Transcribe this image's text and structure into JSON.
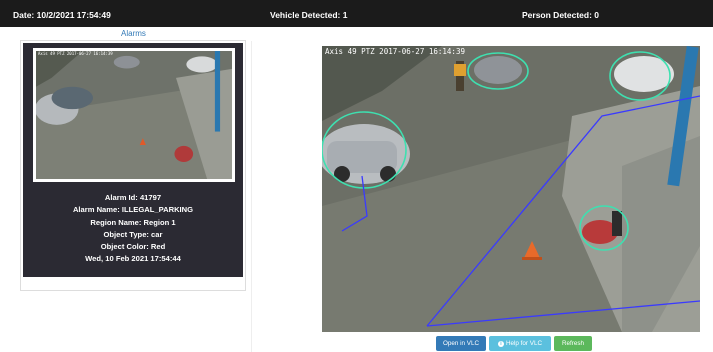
{
  "header": {
    "date": "Date: 10/2/2021 17:54:49",
    "vehicle": "Vehicle Detected: 1",
    "person": "Person Detected: 0"
  },
  "tabs": {
    "alarms_label": "Alarms"
  },
  "alarm": {
    "thumb_overlay": "Axis 49 PTZ 2017-06-27 16:14:39",
    "alarm_id": "Alarm Id: 41797",
    "alarm_name": "Alarm Name: ILLEGAL_PARKING",
    "region_name": "Region Name: Region 1",
    "object_type": "Object Type: car",
    "object_color": "Object Color: Red",
    "timestamp": "Wed, 10 Feb 2021 17:54:44"
  },
  "camera": {
    "overlay_text": "Axis 49 PTZ 2017-06-27 16:14:39"
  },
  "buttons": {
    "open_vlc": "Open in VLC",
    "help_vlc": "Help for VLC",
    "refresh": "Refresh"
  },
  "colors": {
    "topbar_bg": "#1b1b1b",
    "card_bg": "#2b2a33",
    "link": "#337ab7",
    "btn_primary": "#337ab7",
    "btn_info": "#5bc0de",
    "btn_success": "#5cb85c",
    "detection_ellipse": "#3ee0b0",
    "region_line": "#3a3aff"
  }
}
